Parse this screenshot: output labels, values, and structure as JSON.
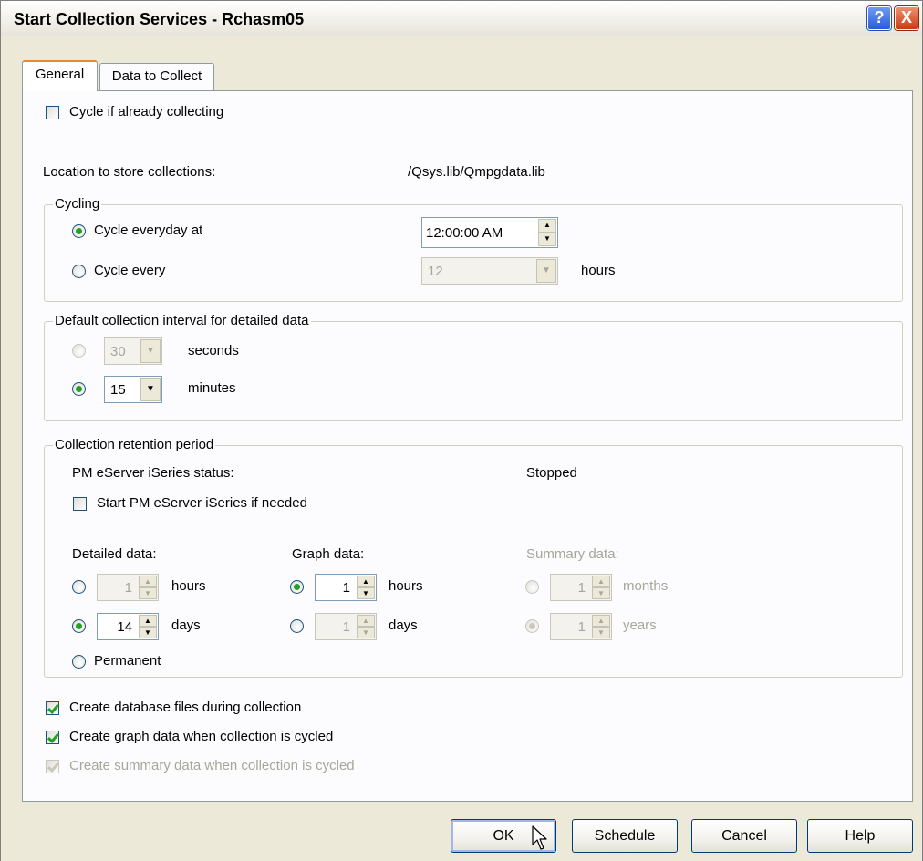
{
  "window": {
    "title": "Start Collection Services - Rchasm05",
    "help_glyph": "?",
    "close_glyph": "X"
  },
  "tabs": [
    {
      "label": "General",
      "selected": true
    },
    {
      "label": "Data to Collect",
      "selected": false
    }
  ],
  "general": {
    "cycle_if_collecting": {
      "label": "Cycle if already collecting",
      "checked": false
    },
    "location": {
      "label": "Location to store collections:",
      "value": "/Qsys.lib/Qmpgdata.lib"
    },
    "cycling": {
      "group_label": "Cycling",
      "everyday": {
        "label": "Cycle everyday at",
        "selected": true,
        "value": "12:00:00 AM"
      },
      "every": {
        "label": "Cycle every",
        "selected": false,
        "value": "12",
        "unit": "hours"
      }
    },
    "interval": {
      "group_label": "Default collection interval for detailed data",
      "seconds": {
        "value": "30",
        "unit": "seconds",
        "selected": false
      },
      "minutes": {
        "value": "15",
        "unit": "minutes",
        "selected": true
      }
    },
    "retention": {
      "group_label": "Collection retention period",
      "pm_status_label": "PM eServer iSeries status:",
      "pm_status_value": "Stopped",
      "start_pm": {
        "label": "Start PM eServer iSeries if needed",
        "checked": false
      },
      "detailed": {
        "label": "Detailed data:",
        "hours": {
          "value": "1",
          "unit": "hours",
          "selected": false
        },
        "days": {
          "value": "14",
          "unit": "days",
          "selected": true
        },
        "permanent": {
          "label": "Permanent",
          "selected": false
        }
      },
      "graph": {
        "label": "Graph data:",
        "hours": {
          "value": "1",
          "unit": "hours",
          "selected": true
        },
        "days": {
          "value": "1",
          "unit": "days",
          "selected": false
        }
      },
      "summary": {
        "label": "Summary data:",
        "months": {
          "value": "1",
          "unit": "months",
          "selected": false
        },
        "years": {
          "value": "1",
          "unit": "years",
          "selected": true
        }
      }
    },
    "create_db": {
      "label": "Create database files during collection",
      "checked": true
    },
    "create_graph": {
      "label": "Create graph data when collection is cycled",
      "checked": true
    },
    "create_summary": {
      "label": "Create summary data when collection is cycled",
      "checked": true,
      "disabled": true
    }
  },
  "buttons": {
    "ok": "OK",
    "schedule": "Schedule",
    "cancel": "Cancel",
    "help": "Help"
  },
  "icons": {
    "spin_up": "▲",
    "spin_down": "▼",
    "dropdown": "▼"
  },
  "colors": {
    "dialog_bg": "#ece9d8",
    "panel_bg": "#fcfcfe",
    "check_green": "#21a121",
    "close_red": "#c93a14",
    "help_blue": "#2a5bdc",
    "tab_highlight": "#e68b2c"
  }
}
